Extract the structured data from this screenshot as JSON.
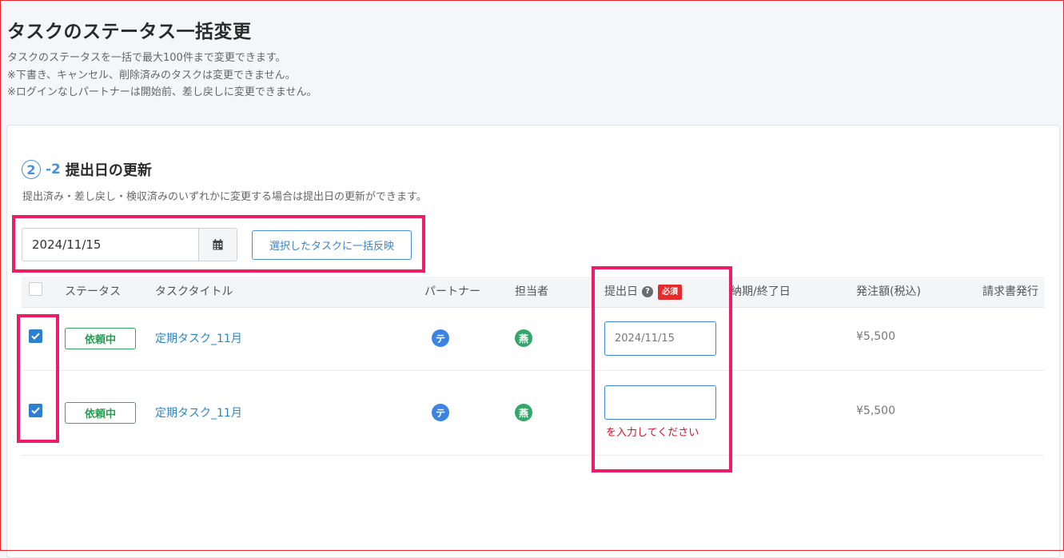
{
  "page": {
    "title": "タスクのステータス一括変更",
    "description": [
      "タスクのステータスを一括で最大100件まで変更できます。",
      "※下書き、キャンセル、削除済みのタスクは変更できません。",
      "※ログインなしパートナーは開始前、差し戻しに変更できません。"
    ]
  },
  "section": {
    "step_number": "2",
    "step_sub": "-2",
    "title": "提出日の更新",
    "description": "提出済み・差し戻し・検収済みのいずれかに変更する場合は提出日の更新ができます。"
  },
  "bulk": {
    "date_value": "2024/11/15",
    "calendar_icon": "calendar-icon",
    "apply_label": "選択したタスクに一括反映"
  },
  "table": {
    "headers": {
      "status": "ステータス",
      "task_title": "タスクタイトル",
      "partner": "パートナー",
      "assignee": "担当者",
      "submit_date": "提出日",
      "required": "必須",
      "deadline": "納期/終了日",
      "amount": "発注額(税込)",
      "invoice": "請求書発行"
    },
    "rows": [
      {
        "checked": true,
        "status": "依頼中",
        "task_title": "定期タスク_11月",
        "partner_initial": "テ",
        "assignee_initial": "燕",
        "submit_date": "2024/11/15",
        "amount": "¥5,500",
        "error": ""
      },
      {
        "checked": true,
        "status": "依頼中",
        "task_title": "定期タスク_11月",
        "partner_initial": "テ",
        "assignee_initial": "燕",
        "submit_date": "",
        "amount": "¥5,500",
        "error": "を入力してください"
      }
    ]
  },
  "colors": {
    "accent": "#2f7fd1",
    "status_green": "#36a55f",
    "required_red": "#e52b2b",
    "highlight_pink": "#ec1c67",
    "error_red": "#d6102a"
  }
}
